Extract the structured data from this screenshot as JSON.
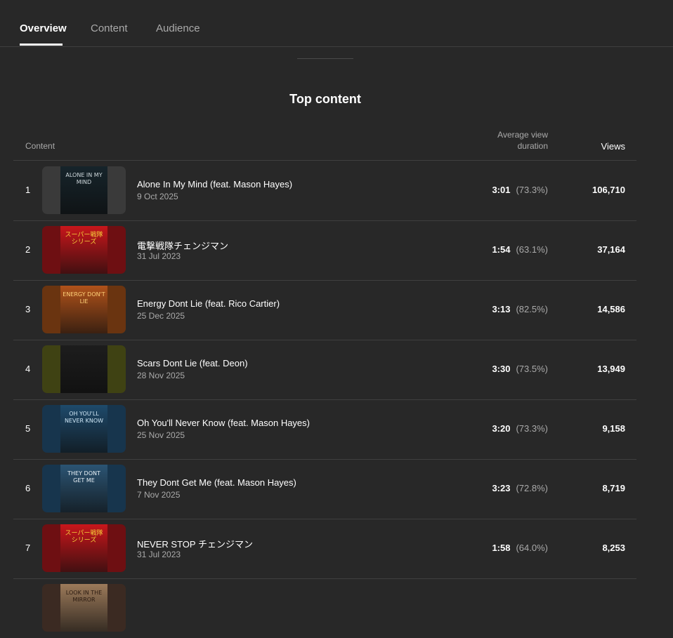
{
  "tabs": [
    "Overview",
    "Content",
    "Audience"
  ],
  "section_title": "Top content",
  "headers": {
    "content": "Content",
    "avd_line1": "Average view",
    "avd_line2": "duration",
    "views": "Views"
  },
  "rows": [
    {
      "rank": "1",
      "title": "Alone In My Mind (feat. Mason Hayes)",
      "date": "9 Oct 2025",
      "duration": "3:01",
      "percent": "(73.3%)",
      "views": "106,710",
      "thumb_art_text": "ALONE IN MY MIND",
      "colors": {
        "bg": "#3a3a3a",
        "art": "#16242b",
        "text": "#cfd8dc"
      }
    },
    {
      "rank": "2",
      "title": "電撃戦隊チェンジマン",
      "date": "31 Jul 2023",
      "duration": "1:54",
      "percent": "(63.1%)",
      "views": "37,164",
      "thumb_art_text": "スーパー戦隊シリーズ",
      "colors": {
        "bg": "#6e0f12",
        "art": "#c8161b",
        "text": "#f5d23a"
      }
    },
    {
      "rank": "3",
      "title": "Energy Dont Lie (feat. Rico Cartier)",
      "date": "25 Dec 2025",
      "duration": "3:13",
      "percent": "(82.5%)",
      "views": "14,586",
      "thumb_art_text": "ENERGY DON'T LIE",
      "colors": {
        "bg": "#6a3410",
        "art": "#b0521a",
        "text": "#ffd27a"
      }
    },
    {
      "rank": "4",
      "title": "Scars Dont Lie (feat. Deon)",
      "date": "28 Nov 2025",
      "duration": "3:30",
      "percent": "(73.5%)",
      "views": "13,949",
      "thumb_art_text": "",
      "colors": {
        "bg": "#3f4213",
        "art": "#1d1d1d",
        "text": "#888888"
      }
    },
    {
      "rank": "5",
      "title": "Oh You'll Never Know (feat. Mason Hayes)",
      "date": "25 Nov 2025",
      "duration": "3:20",
      "percent": "(73.3%)",
      "views": "9,158",
      "thumb_art_text": "OH YOU'LL NEVER KNOW",
      "colors": {
        "bg": "#17354d",
        "art": "#1e4a6b",
        "text": "#cfe6f5"
      }
    },
    {
      "rank": "6",
      "title": "They Dont Get Me (feat. Mason Hayes)",
      "date": "7 Nov 2025",
      "duration": "3:23",
      "percent": "(72.8%)",
      "views": "8,719",
      "thumb_art_text": "THEY DONT GET ME",
      "colors": {
        "bg": "#17354d",
        "art": "#2b5473",
        "text": "#e8f0f5"
      }
    },
    {
      "rank": "7",
      "title": "NEVER STOP チェンジマン",
      "date": "31 Jul 2023",
      "duration": "1:58",
      "percent": "(64.0%)",
      "views": "8,253",
      "thumb_art_text": "スーパー戦隊シリーズ",
      "colors": {
        "bg": "#6e0f12",
        "art": "#c8161b",
        "text": "#f5d23a"
      }
    },
    {
      "rank": "",
      "title": "",
      "date": "",
      "duration": "",
      "percent": "",
      "views": "",
      "thumb_art_text": "LOOK IN THE MIRROR",
      "colors": {
        "bg": "#3b2a22",
        "art": "#9c7a5a",
        "text": "#2a1a10"
      }
    }
  ]
}
